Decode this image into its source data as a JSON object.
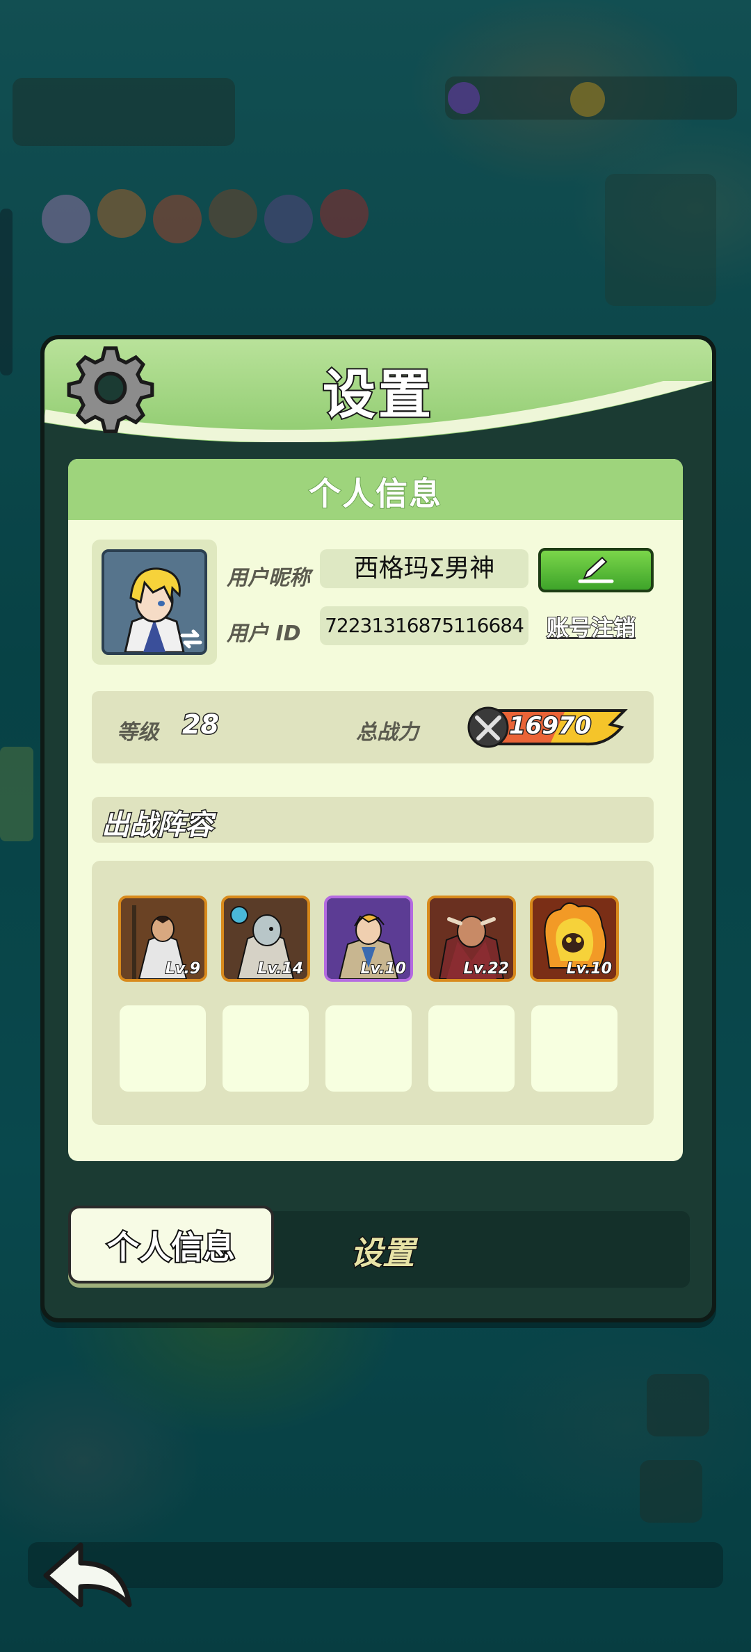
{
  "dialog": {
    "title": "设置",
    "section_title": "个人信息"
  },
  "profile": {
    "nickname_label": "用户昵称",
    "nickname": "西格玛Σ男神",
    "id_label": "用户 ID",
    "user_id": "72231316875116684",
    "logout_label": "账号注销",
    "level_label": "等级",
    "level": "28",
    "power_label": "总战力",
    "power": "16970"
  },
  "lineup": {
    "title": "出战阵容",
    "heroes": [
      {
        "level": "Lv.9",
        "frame_color": "#d88a1c"
      },
      {
        "level": "Lv.14",
        "frame_color": "#d88a1c"
      },
      {
        "level": "Lv.10",
        "frame_color": "#b46be0"
      },
      {
        "level": "Lv.22",
        "frame_color": "#d88a1c"
      },
      {
        "level": "Lv.10",
        "frame_color": "#d88a1c"
      }
    ],
    "empty_slots": 5
  },
  "tabs": [
    {
      "label": "个人信息",
      "active": true
    },
    {
      "label": "设置",
      "active": false
    }
  ],
  "icons": {
    "settings": "gear-icon",
    "edit": "pencil-icon",
    "power": "crossed-swords-icon",
    "back": "back-arrow-icon",
    "avatar_swap": "swap-icon"
  }
}
